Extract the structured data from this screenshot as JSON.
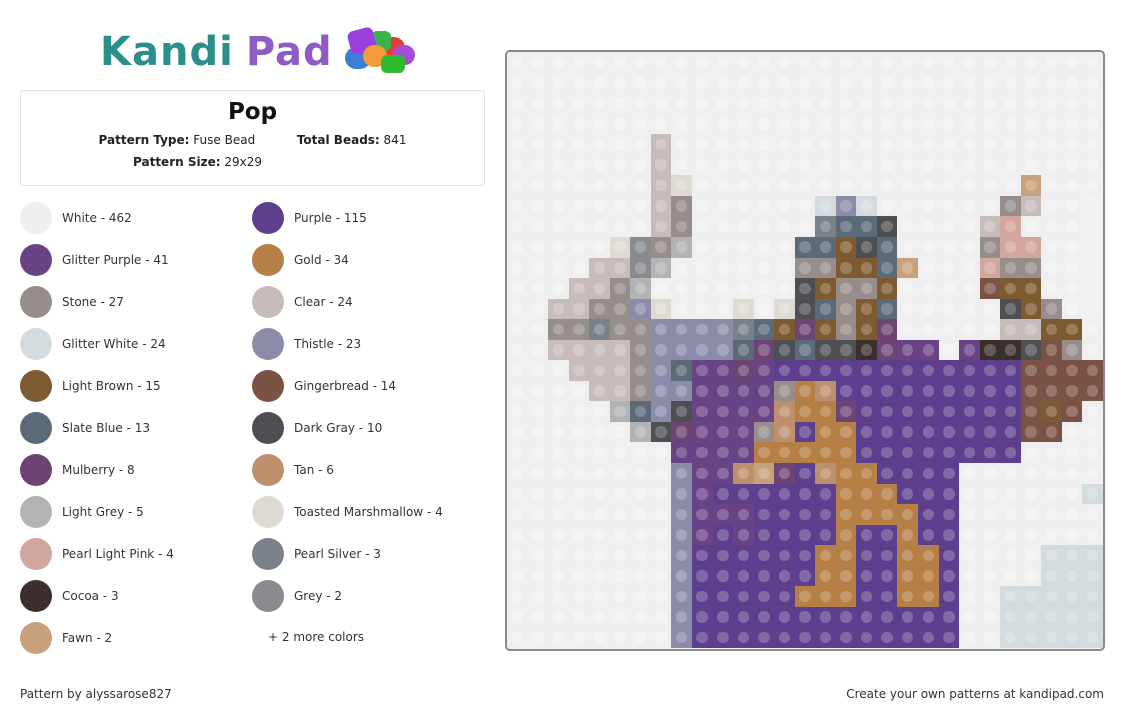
{
  "logo": {
    "part1": "Kandi",
    "part2": "Pad"
  },
  "pattern": {
    "title": "Pop",
    "type_label": "Pattern Type:",
    "type_value": "Fuse Bead",
    "beads_label": "Total Beads:",
    "beads_value": "841",
    "size_label": "Pattern Size:",
    "size_value": "29x29"
  },
  "palette": [
    {
      "code": "W",
      "name": "White",
      "count": 462,
      "label": "White - 462",
      "color": "#efefef"
    },
    {
      "code": "P",
      "name": "Purple",
      "count": 115,
      "label": "Purple - 115",
      "color": "#5e3f8e"
    },
    {
      "code": "GP",
      "name": "Glitter Purple",
      "count": 41,
      "label": "Glitter Purple - 41",
      "color": "#6a4386"
    },
    {
      "code": "GO",
      "name": "Gold",
      "count": 34,
      "label": "Gold - 34",
      "color": "#b57f45"
    },
    {
      "code": "S",
      "name": "Stone",
      "count": 27,
      "label": "Stone - 27",
      "color": "#978d8b"
    },
    {
      "code": "CL",
      "name": "Clear",
      "count": 24,
      "label": "Clear - 24",
      "color": "#c8bcba"
    },
    {
      "code": "GW",
      "name": "Glitter White",
      "count": 24,
      "label": "Glitter White - 24",
      "color": "#d2dbde"
    },
    {
      "code": "TH",
      "name": "Thistle",
      "count": 23,
      "label": "Thistle - 23",
      "color": "#8c8caa"
    },
    {
      "code": "LB",
      "name": "Light Brown",
      "count": 15,
      "label": "Light Brown - 15",
      "color": "#7e5a31"
    },
    {
      "code": "GB",
      "name": "Gingerbread",
      "count": 14,
      "label": "Gingerbread - 14",
      "color": "#7b5345"
    },
    {
      "code": "SB",
      "name": "Slate Blue",
      "count": 13,
      "label": "Slate Blue - 13",
      "color": "#5b6a79"
    },
    {
      "code": "DG",
      "name": "Dark Gray",
      "count": 10,
      "label": "Dark Gray - 10",
      "color": "#4e4f52"
    },
    {
      "code": "MU",
      "name": "Mulberry",
      "count": 8,
      "label": "Mulberry - 8",
      "color": "#6d4474"
    },
    {
      "code": "TA",
      "name": "Tan",
      "count": 6,
      "label": "Tan - 6",
      "color": "#bd8f6d"
    },
    {
      "code": "LG",
      "name": "Light Grey",
      "count": 5,
      "label": "Light Grey - 5",
      "color": "#b2b3b5"
    },
    {
      "code": "TM",
      "name": "Toasted Marshmallow",
      "count": 4,
      "label": "Toasted Marshmallow - 4",
      "color": "#dedad2"
    },
    {
      "code": "PP",
      "name": "Pearl Light Pink",
      "count": 4,
      "label": "Pearl Light Pink - 4",
      "color": "#d1a69c"
    },
    {
      "code": "PS",
      "name": "Pearl Silver",
      "count": 3,
      "label": "Pearl Silver - 3",
      "color": "#7b8189"
    },
    {
      "code": "CO",
      "name": "Cocoa",
      "count": 3,
      "label": "Cocoa - 3",
      "color": "#3a2f2c"
    },
    {
      "code": "GR",
      "name": "Grey",
      "count": 2,
      "label": "Grey - 2",
      "color": "#8a8b8e"
    },
    {
      "code": "FA",
      "name": "Fawn",
      "count": 2,
      "label": "Fawn - 2",
      "color": "#c9a07c"
    }
  ],
  "more_colors": "+ 2 more colors",
  "grid": {
    "cols": 29,
    "rows": [
      "W W W W W W W W W W W W W W W W W W W W W W W W W W W W W",
      "W W W W W W W W W W W W W W W W W W W W W W W W W W W W W",
      "W W W W W W W W W W W W W W W W W W W W W W W W W W W W W",
      "W W W W W W W W W W W W W W W W W W W W W W W W W W W W W",
      "W W W W W W W CL W W W W W W W W W W W W W W W W W W W W W",
      "W W W W W W W CL W W W W W W W W W W W W W W W W W W W W W",
      "W W W W W W W CL TM W W W W W W W W W W W W W W W W FA W W W",
      "W W W W W W W CL S W W W W W W GW TH GW W W W W W W S CL W W",
      "W W W W W W W CL S W W W W W W PS SB SB DG W W W W CL PP W W W",
      "W W W W W TM GR S LG W W W W W SB SB LB DG SB W W W W S PP PP W W",
      "W W W W CL CL GR LG W W W W W W S S LB LB SB FA W W W PP S S W W",
      "W W W CL CL S LG W W W W W W W DG LB S S LB W W W W GB LB LB W W",
      "W W CL CL S S TH TM W W W TM W TM DG SB S LB SB W W W W W DG LB S W",
      "W W S S PS S S TH TH TH TH PS SB LB MU LB S LB MU W W W W W CL CL LB LB W",
      "W W CL CL CL CL S TH TH TH TH SB MU DG SB DG DG CO MU GP GP W GP CO CO DG GB S W",
      "W W W CL CL CL S TH SB GP GP MU GP P P P P P P P P P P P P GB GB GB GB",
      "W W W W CL CL S TH TH GP GP GP GP S GO TA P P P P P P P P P GB GB GB GB",
      "W W W W W LG SB TH DG GP GP GP GP TA GO GO MU P P P P P P P P GB LB GB W",
      "W W W W W W LG DG MU GP GP GP S TA P GO GO P P P P P P P P GB GB W W",
      "W W W W W W W W GP GP GP GP GO GO GO GO GO P P P P P P P P W W W W",
      "W W W W W W W W TH GP GP TA FA MU P TA GO GO P P P P W W W W W W W",
      "W W W W W W W W TH GP P P P P P P GO GO GO P P P W W W W W W GW",
      "W W W W W W W W TH GP GP GP P P P P GO GO GO GO P P W W W W W W W",
      "W W W W W W W W TH GP P GP P P P P GO P P GO P P W W W W W W W",
      "W W W W W W W W TH P P P P P P GO GO P P GO GO P W W W W GW GW GW",
      "W W W W W W W W TH P P P P P P GO GO P P GO GO P W W W W GW GW GW",
      "W W W W W W W W TH P P P P P GO GO GO P P GO GO P W W GW GW GW GW GW",
      "W W W W W W W W TH P P P P P P P P P P P P P W W GW GW GW GW GW",
      "W W W W W W W W TH P P P P P P P P P P P P P W W GW GW GW GW GW"
    ]
  },
  "footer": {
    "author": "Pattern by alyssarose827",
    "promo": "Create your own patterns at kandipad.com"
  }
}
